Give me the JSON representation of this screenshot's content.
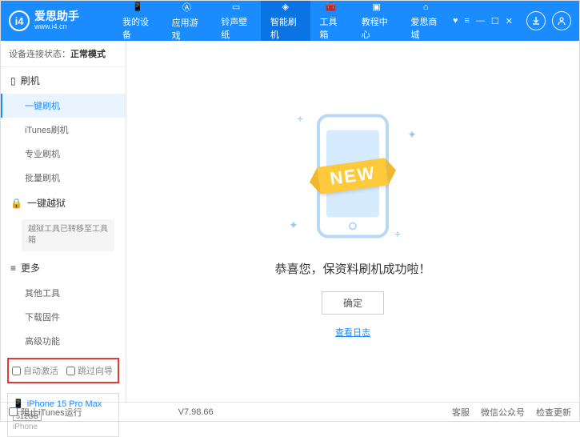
{
  "app": {
    "title": "爱思助手",
    "url": "www.i4.cn"
  },
  "nav": {
    "items": [
      {
        "label": "我的设备"
      },
      {
        "label": "应用游戏"
      },
      {
        "label": "铃声壁纸"
      },
      {
        "label": "智能刷机"
      },
      {
        "label": "工具箱"
      },
      {
        "label": "教程中心"
      },
      {
        "label": "爱思商城"
      }
    ],
    "activeIndex": 3
  },
  "sidebar": {
    "statusLabel": "设备连接状态：",
    "statusValue": "正常模式",
    "flashHeader": "刷机",
    "flashItems": [
      "一键刷机",
      "iTunes刷机",
      "专业刷机",
      "批量刷机"
    ],
    "jailbreakHeader": "一键越狱",
    "jailbreakNote": "越狱工具已转移至工具箱",
    "moreHeader": "更多",
    "moreItems": [
      "其他工具",
      "下载固件",
      "高级功能"
    ],
    "checkbox1": "自动激活",
    "checkbox2": "跳过向导"
  },
  "device": {
    "name": "iPhone 15 Pro Max",
    "storage": "512GB",
    "type": "iPhone"
  },
  "content": {
    "ribbon": "NEW",
    "message": "恭喜您，保资料刷机成功啦！",
    "okButton": "确定",
    "logLink": "查看日志"
  },
  "footer": {
    "blockItunes": "阻止iTunes运行",
    "version": "V7.98.66",
    "links": [
      "客服",
      "微信公众号",
      "检查更新"
    ]
  }
}
